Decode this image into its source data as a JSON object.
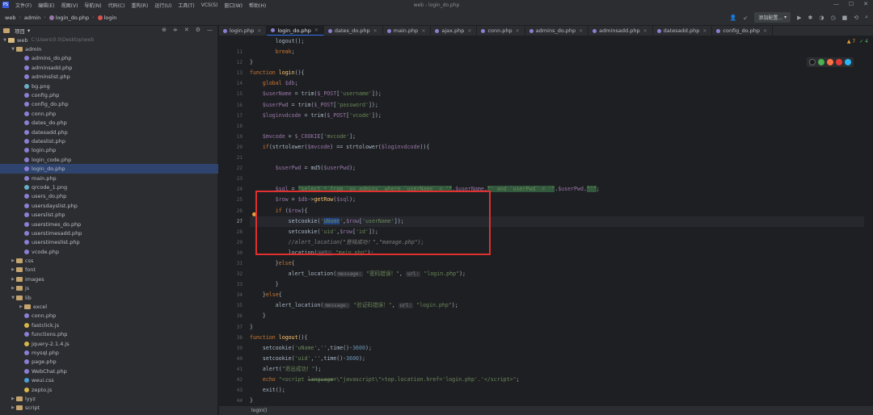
{
  "menubar": {
    "logo": "PS",
    "items": [
      "文件(F)",
      "编辑(E)",
      "视图(V)",
      "导航(N)",
      "代码(C)",
      "重构(R)",
      "运行(U)",
      "工具(T)",
      "VCS(S)",
      "窗口(W)",
      "帮助(H)"
    ],
    "title": "web - login_do.php"
  },
  "breadcrumb": [
    "web",
    "admin",
    "login_do.php",
    "login"
  ],
  "navbar": {
    "run_config": "添加配置..."
  },
  "project": {
    "title": "项目",
    "root": "web",
    "root_path": "C:\\Users\\0.0\\Desktop\\web",
    "admin_folder": "admin",
    "admin_files": [
      "admins_do.php",
      "adminsadd.php",
      "adminslist.php",
      "bg.png",
      "config.php",
      "config_do.php",
      "conn.php",
      "dates_do.php",
      "datesadd.php",
      "dateslist.php",
      "login.php",
      "login_code.php",
      "login_do.php",
      "main.php",
      "qrcode_1.png",
      "users_do.php",
      "usersdayslist.php",
      "userslist.php",
      "userstimes_do.php",
      "userstimesadd.php",
      "userstimeslist.php",
      "vcode.php"
    ],
    "folders_top": [
      "css",
      "font",
      "images",
      "js"
    ],
    "lib_folder": "lib",
    "lib_items": [
      "excel",
      "conn.php",
      "fastclick.js",
      "functions.php",
      "jquery-2.1.4.js",
      "mysql.php",
      "page.php",
      "WebChat.php",
      "weui.css",
      "zepto.js"
    ],
    "folders_bottom": [
      "lyyz",
      "script"
    ]
  },
  "tabs": [
    "login.php",
    "login_do.php",
    "dates_do.php",
    "main.php",
    "ajax.php",
    "conn.php",
    "admins_do.php",
    "adminsadd.php",
    "datesadd.php",
    "config_do.php"
  ],
  "editor": {
    "line_numbers": [
      "",
      "11",
      "12",
      "13",
      "14",
      "15",
      "16",
      "17",
      "18",
      "19",
      "20",
      "21",
      "22",
      "23",
      "24",
      "25",
      "26",
      "27",
      "28",
      "29",
      "30",
      "31",
      "32",
      "33",
      "34",
      "35",
      "36",
      "37",
      "38",
      "39",
      "40",
      "41",
      "42",
      "43",
      "44"
    ],
    "inspections_warn": "▲ 7",
    "inspections_ok": "✓ 4",
    "colors": {
      "selection_box": "#e0302f",
      "caret_word": "#214283"
    }
  },
  "statusbar": {
    "location": "login()"
  }
}
